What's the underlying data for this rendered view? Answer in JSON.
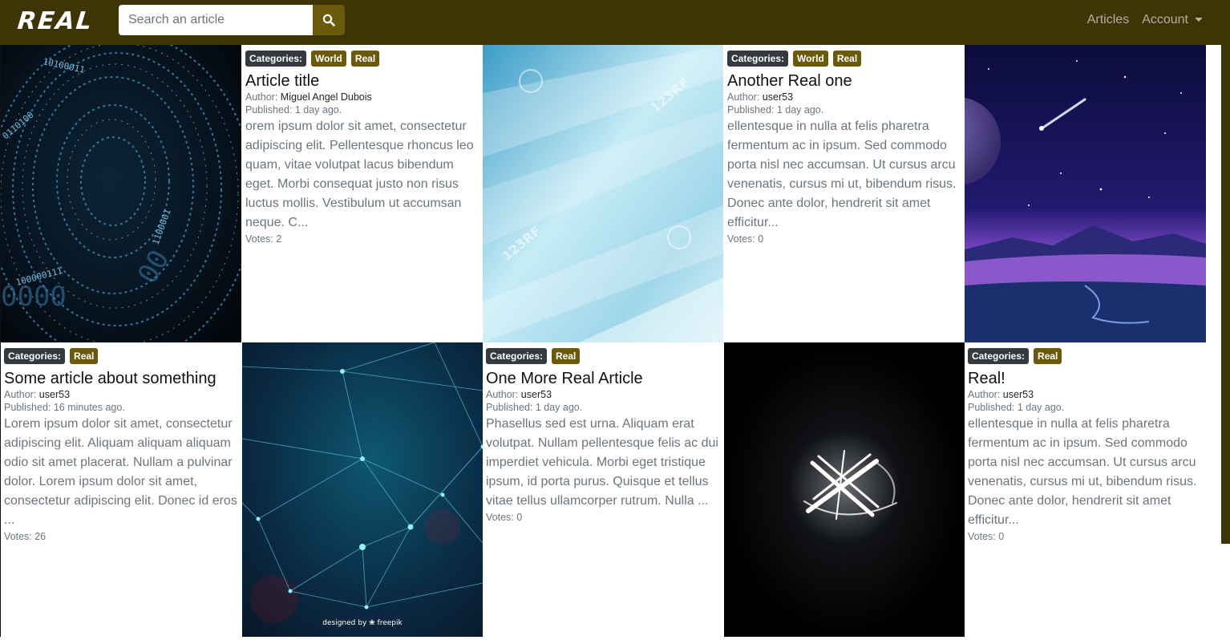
{
  "brand": {
    "logo_text": "REAL"
  },
  "search": {
    "placeholder": "Search an article",
    "button_icon": "search-icon"
  },
  "nav": {
    "articles": "Articles",
    "account": "Account"
  },
  "colors": {
    "navbar": "#3d3505",
    "accent": "#6b5a0c",
    "category_badge": "#343a40"
  },
  "articles": [
    {
      "categories_label": "Categories:",
      "tags": [
        "World",
        "Real"
      ],
      "title": "Article title",
      "author_label": "Author:",
      "author": "Miguel Angel Dubois",
      "published": "Published: 1 day ago.",
      "excerpt": "orem ipsum dolor sit amet, consectetur adipiscing elit. Pellentesque rhoncus leo quam, vitae volutpat lacus bibendum eget. Morbi consequat justo non risus luctus mollis. Vestibulum ut accumsan neque. C...",
      "votes": "Votes: 2"
    },
    {
      "categories_label": "Categories:",
      "tags": [
        "World",
        "Real"
      ],
      "title": "Another Real one",
      "author_label": "Author:",
      "author": "user53",
      "published": "Published: 1 day ago.",
      "excerpt": "ellentesque in nulla at felis pharetra fermentum ac in ipsum. Sed commodo porta nisl nec accumsan. Ut cursus arcu venenatis, cursus mi ut, bibendum risus. Donec ante dolor, hendrerit sit amet efficitur...",
      "votes": "Votes: 0"
    },
    {
      "categories_label": "Categories:",
      "tags": [
        "Real"
      ],
      "title": "Some article about something",
      "author_label": "Author:",
      "author": "user53",
      "published": "Published: 16 minutes ago.",
      "excerpt": "Lorem ipsum dolor sit amet, consectetur adipiscing elit. Aliquam aliquam aliquam odio sit amet placerat. Nullam a pulvinar dolor. Lorem ipsum dolor sit amet, consectetur adipiscing elit. Donec id eros ...",
      "votes": "Votes: 26"
    },
    {
      "categories_label": "Categories:",
      "tags": [
        "Real"
      ],
      "title": "One More Real Article",
      "author_label": "Author:",
      "author": "user53",
      "published": "Published: 1 day ago.",
      "excerpt": "Phasellus sed est urna. Aliquam erat volutpat. Nullam pellentesque felis ac dui imperdiet vehicula. Morbi eget tristique ipsum, id porta purus. Quisque et tellus vitae tellus ullamcorper rutrum. Nulla ...",
      "votes": "Votes: 0"
    },
    {
      "categories_label": "Categories:",
      "tags": [
        "Real"
      ],
      "title": "Real!",
      "author_label": "Author:",
      "author": "user53",
      "published": "Published: 1 day ago.",
      "excerpt": "ellentesque in nulla at felis pharetra fermentum ac in ipsum. Sed commodo porta nisl nec accumsan. Ut cursus arcu venenatis, cursus mi ut, bibendum risus. Donec ante dolor, hendrerit sit amet efficitur...",
      "votes": "Votes: 0"
    }
  ],
  "images": {
    "binary": {
      "name": "binary-code-vortex-image"
    },
    "watermark": {
      "name": "light-blue-abstract-image",
      "watermark_text": "123RF"
    },
    "space": {
      "name": "space-landscape-image"
    },
    "network": {
      "name": "network-mesh-image",
      "credit": "designed by ❀ freepik"
    },
    "logo_x": {
      "name": "glowing-x-image"
    }
  }
}
